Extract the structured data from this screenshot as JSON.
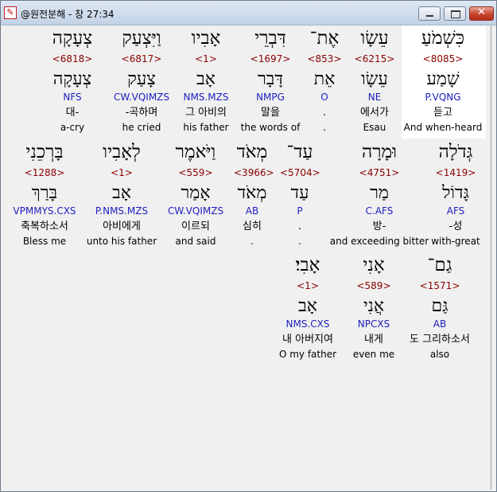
{
  "window": {
    "title": "@원전분해 - 창 27:34",
    "icon": "app-logo-icon",
    "close_glyph": "✕"
  },
  "lines": [
    {
      "words": [
        {
          "heb": "כִּשְׁמֹעַ",
          "num": "<8085>",
          "root": "שָׁמַע",
          "parse": "P.VQNG",
          "ko": "듣고",
          "en": "And when-heard",
          "selected": true
        },
        {
          "heb": "עֵשָׂו",
          "num": "<6215>",
          "root": "עֵשָׂו",
          "parse": "NE",
          "ko": "에서가",
          "en": "Esau"
        },
        {
          "heb": "אֶת־",
          "num": "<853>",
          "root": "אֵת",
          "parse": "O",
          "ko": ".",
          "en": "."
        },
        {
          "heb": "דִּבְרֵי",
          "num": "<1697>",
          "root": "דָּבָר",
          "parse": "NMPG",
          "ko": "말을",
          "en": "the words of"
        },
        {
          "heb": "אָבִיו",
          "num": "<1>",
          "root": "אָב",
          "parse": "NMS.MZS",
          "ko": "그 아비의",
          "en": "his father"
        },
        {
          "heb": "וַיִּצְעַק",
          "num": "<6817>",
          "root": "צָעַק",
          "parse": "CW.VQIMZS",
          "ko": "-곡하며",
          "en": "he cried"
        },
        {
          "heb": "צְעָקָה",
          "num": "<6818>",
          "root": "צְעָקָה",
          "parse": "NFS",
          "ko": "대-",
          "en": "a-cry"
        }
      ]
    },
    {
      "words": [
        {
          "heb": "גְּדֹלָה",
          "num": "<1419>",
          "root": "גָּדוֹל",
          "parse": "AFS",
          "ko": "-성",
          "en": "with-great"
        },
        {
          "heb": "וּמָרָה",
          "num": "<4751>",
          "root": "מַר",
          "parse": "C.AFS",
          "ko": "방-",
          "en": "and exceeding bitter"
        },
        {
          "heb": "עַד־",
          "num": "<5704>",
          "root": "עַד",
          "parse": "P",
          "ko": ".",
          "en": "."
        },
        {
          "heb": "מְאֹד",
          "num": "<3966>",
          "root": "מְאֹד",
          "parse": "AB",
          "ko": "심히",
          "en": "."
        },
        {
          "heb": "וַיֹּאמֶר",
          "num": "<559>",
          "root": "אָמַר",
          "parse": "CW.VQIMZS",
          "ko": "이르되",
          "en": "and said"
        },
        {
          "heb": "לְאָבִיו",
          "num": "<1>",
          "root": "אָב",
          "parse": "P.NMS.MZS",
          "ko": "아비에게",
          "en": "unto his father"
        },
        {
          "heb": "בָּרְכֵנִי",
          "num": "<1288>",
          "root": "בָּרַךְ",
          "parse": "VPMMYS.CXS",
          "ko": "축복하소서",
          "en": "Bless me"
        }
      ]
    },
    {
      "words": [
        {
          "heb": "גַם־",
          "num": "<1571>",
          "root": "גַּם",
          "parse": "AB",
          "ko": "도 그리하소서",
          "en": "also"
        },
        {
          "heb": "אָנִי",
          "num": "<589>",
          "root": "אֲנִי",
          "parse": "NPCXS",
          "ko": "내게",
          "en": "even me"
        },
        {
          "heb": "אָבִי׃",
          "num": "<1>",
          "root": "אָב",
          "parse": "NMS.CXS",
          "ko": "내 아버지여",
          "en": "O my father"
        }
      ]
    }
  ]
}
